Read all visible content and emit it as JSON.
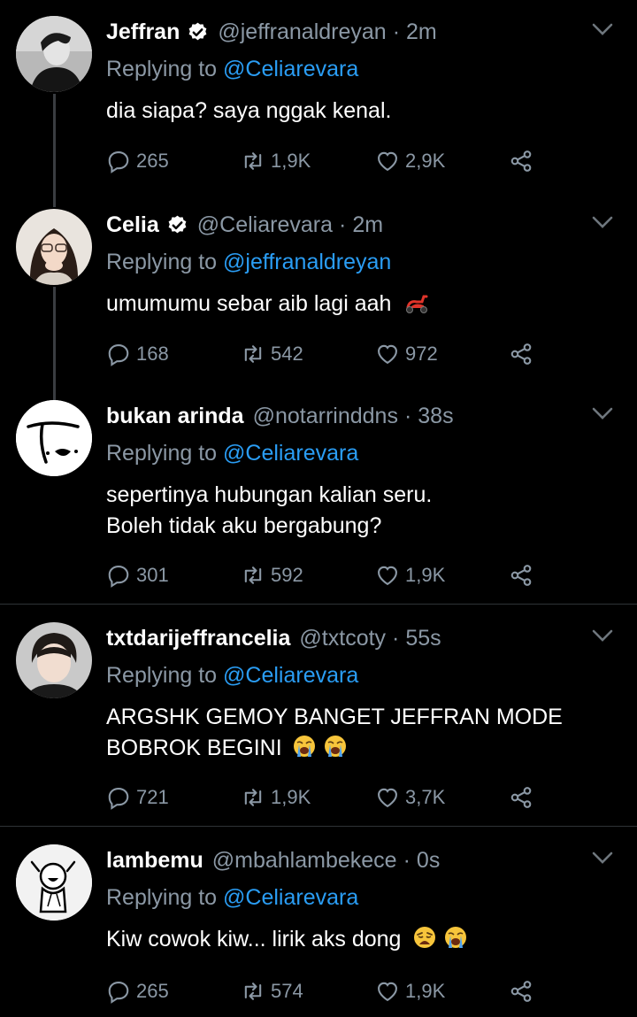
{
  "tweets": [
    {
      "name": "Jeffran",
      "verified": true,
      "handle": "@jeffranaldreyan",
      "time": "2m",
      "replying_prefix": "Replying to",
      "replying_to": "@Celiarevara",
      "text": "dia siapa? saya nggak kenal.",
      "text_line2": "",
      "emoji": "",
      "stats": {
        "replies": "265",
        "retweets": "1,9K",
        "likes": "2,9K"
      }
    },
    {
      "name": "Celia",
      "verified": true,
      "handle": "@Celiarevara",
      "time": "2m",
      "replying_prefix": "Replying to",
      "replying_to": "@jeffranaldreyan",
      "text": "umumumu sebar aib lagi aah",
      "text_line2": "",
      "emoji": "scooter-emoji",
      "stats": {
        "replies": "168",
        "retweets": "542",
        "likes": "972"
      }
    },
    {
      "name": "bukan arinda",
      "verified": false,
      "handle": "@notarrinddns",
      "time": "38s",
      "replying_prefix": "Replying to",
      "replying_to": "@Celiarevara",
      "text": "sepertinya hubungan kalian seru.",
      "text_line2": "Boleh tidak aku bergabung?",
      "emoji": "",
      "stats": {
        "replies": "301",
        "retweets": "592",
        "likes": "1,9K"
      }
    },
    {
      "name": "txtdarijeffrancelia",
      "verified": false,
      "handle": "@txtcoty",
      "time": "55s",
      "replying_prefix": "Replying to",
      "replying_to": "@Celiarevara",
      "text": "ARGSHK GEMOY BANGET JEFFRAN MODE",
      "text_line2": "BOBROK BEGINI",
      "emoji": "crying-emoji x2",
      "stats": {
        "replies": "721",
        "retweets": "1,9K",
        "likes": "3,7K"
      }
    },
    {
      "name": "lambemu",
      "verified": false,
      "handle": "@mbahlambekece",
      "time": "0s",
      "replying_prefix": "Replying to",
      "replying_to": "@Celiarevara",
      "text": "Kiw cowok kiw... lirik aks dong",
      "text_line2": "",
      "emoji": "weary-emoji crying-emoji",
      "stats": {
        "replies": "265",
        "retweets": "574",
        "likes": "1,9K"
      }
    }
  ],
  "colors": {
    "background": "#000000",
    "secondary_text": "#8b98a5",
    "link": "#2a9df4",
    "divider": "#2f3336"
  },
  "icons": [
    "verified-badge-icon",
    "chevron-down-icon",
    "reply-icon",
    "retweet-icon",
    "like-icon",
    "share-icon"
  ]
}
